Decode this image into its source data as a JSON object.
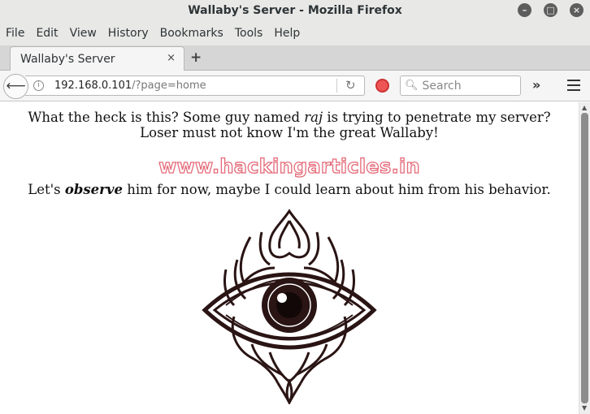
{
  "window": {
    "title": "Wallaby's Server - Mozilla Firefox"
  },
  "menubar": [
    {
      "label": "File"
    },
    {
      "label": "Edit"
    },
    {
      "label": "View"
    },
    {
      "label": "History"
    },
    {
      "label": "Bookmarks"
    },
    {
      "label": "Tools"
    },
    {
      "label": "Help"
    }
  ],
  "tab": {
    "label": "Wallaby's Server",
    "close": "×",
    "new": "+"
  },
  "nav": {
    "back": "⟵",
    "url_host": "192.168.0.101",
    "url_path": "/?page=home",
    "reload": "↻",
    "search_placeholder": "Search",
    "overflow": "»"
  },
  "content": {
    "p1_a": "What the heck is this? Some guy named ",
    "p1_name": "raj",
    "p1_b": " is trying to penetrate my server? Loser must not know I'm the great Wallaby!",
    "watermark": "www.hackingarticles.in",
    "p2_a": "Let's ",
    "p2_em": "observe",
    "p2_b": " him for now, maybe I could learn about him from his behavior."
  },
  "colors": {
    "eye_ink": "#2a1414",
    "watermark_stroke": "#e46a78"
  },
  "icons": {
    "back": "back-arrow-icon",
    "info": "info-icon",
    "reload": "reload-icon",
    "search": "search-icon",
    "menu": "hamburger-menu-icon",
    "eye": "all-seeing-eye-icon"
  }
}
